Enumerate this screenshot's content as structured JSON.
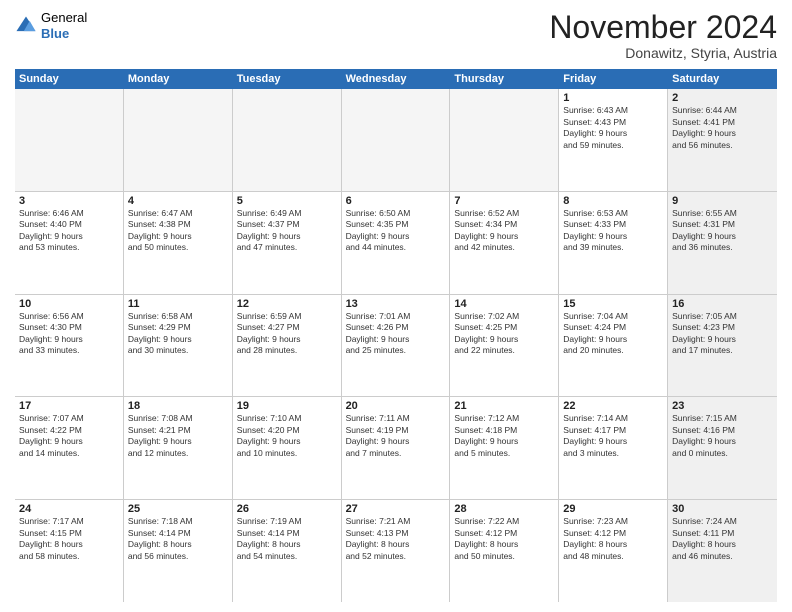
{
  "header": {
    "logo": {
      "general": "General",
      "blue": "Blue"
    },
    "title": "November 2024",
    "subtitle": "Donawitz, Styria, Austria"
  },
  "calendar": {
    "weekdays": [
      "Sunday",
      "Monday",
      "Tuesday",
      "Wednesday",
      "Thursday",
      "Friday",
      "Saturday"
    ],
    "rows": [
      {
        "cells": [
          {
            "empty": true
          },
          {
            "empty": true
          },
          {
            "empty": true
          },
          {
            "empty": true
          },
          {
            "empty": true
          },
          {
            "day": 1,
            "info": "Sunrise: 6:43 AM\nSunset: 4:43 PM\nDaylight: 9 hours\nand 59 minutes.",
            "shaded": false
          },
          {
            "day": 2,
            "info": "Sunrise: 6:44 AM\nSunset: 4:41 PM\nDaylight: 9 hours\nand 56 minutes.",
            "shaded": true
          }
        ]
      },
      {
        "cells": [
          {
            "day": 3,
            "info": "Sunrise: 6:46 AM\nSunset: 4:40 PM\nDaylight: 9 hours\nand 53 minutes.",
            "shaded": false
          },
          {
            "day": 4,
            "info": "Sunrise: 6:47 AM\nSunset: 4:38 PM\nDaylight: 9 hours\nand 50 minutes.",
            "shaded": false
          },
          {
            "day": 5,
            "info": "Sunrise: 6:49 AM\nSunset: 4:37 PM\nDaylight: 9 hours\nand 47 minutes.",
            "shaded": false
          },
          {
            "day": 6,
            "info": "Sunrise: 6:50 AM\nSunset: 4:35 PM\nDaylight: 9 hours\nand 44 minutes.",
            "shaded": false
          },
          {
            "day": 7,
            "info": "Sunrise: 6:52 AM\nSunset: 4:34 PM\nDaylight: 9 hours\nand 42 minutes.",
            "shaded": false
          },
          {
            "day": 8,
            "info": "Sunrise: 6:53 AM\nSunset: 4:33 PM\nDaylight: 9 hours\nand 39 minutes.",
            "shaded": false
          },
          {
            "day": 9,
            "info": "Sunrise: 6:55 AM\nSunset: 4:31 PM\nDaylight: 9 hours\nand 36 minutes.",
            "shaded": true
          }
        ]
      },
      {
        "cells": [
          {
            "day": 10,
            "info": "Sunrise: 6:56 AM\nSunset: 4:30 PM\nDaylight: 9 hours\nand 33 minutes.",
            "shaded": false
          },
          {
            "day": 11,
            "info": "Sunrise: 6:58 AM\nSunset: 4:29 PM\nDaylight: 9 hours\nand 30 minutes.",
            "shaded": false
          },
          {
            "day": 12,
            "info": "Sunrise: 6:59 AM\nSunset: 4:27 PM\nDaylight: 9 hours\nand 28 minutes.",
            "shaded": false
          },
          {
            "day": 13,
            "info": "Sunrise: 7:01 AM\nSunset: 4:26 PM\nDaylight: 9 hours\nand 25 minutes.",
            "shaded": false
          },
          {
            "day": 14,
            "info": "Sunrise: 7:02 AM\nSunset: 4:25 PM\nDaylight: 9 hours\nand 22 minutes.",
            "shaded": false
          },
          {
            "day": 15,
            "info": "Sunrise: 7:04 AM\nSunset: 4:24 PM\nDaylight: 9 hours\nand 20 minutes.",
            "shaded": false
          },
          {
            "day": 16,
            "info": "Sunrise: 7:05 AM\nSunset: 4:23 PM\nDaylight: 9 hours\nand 17 minutes.",
            "shaded": true
          }
        ]
      },
      {
        "cells": [
          {
            "day": 17,
            "info": "Sunrise: 7:07 AM\nSunset: 4:22 PM\nDaylight: 9 hours\nand 14 minutes.",
            "shaded": false
          },
          {
            "day": 18,
            "info": "Sunrise: 7:08 AM\nSunset: 4:21 PM\nDaylight: 9 hours\nand 12 minutes.",
            "shaded": false
          },
          {
            "day": 19,
            "info": "Sunrise: 7:10 AM\nSunset: 4:20 PM\nDaylight: 9 hours\nand 10 minutes.",
            "shaded": false
          },
          {
            "day": 20,
            "info": "Sunrise: 7:11 AM\nSunset: 4:19 PM\nDaylight: 9 hours\nand 7 minutes.",
            "shaded": false
          },
          {
            "day": 21,
            "info": "Sunrise: 7:12 AM\nSunset: 4:18 PM\nDaylight: 9 hours\nand 5 minutes.",
            "shaded": false
          },
          {
            "day": 22,
            "info": "Sunrise: 7:14 AM\nSunset: 4:17 PM\nDaylight: 9 hours\nand 3 minutes.",
            "shaded": false
          },
          {
            "day": 23,
            "info": "Sunrise: 7:15 AM\nSunset: 4:16 PM\nDaylight: 9 hours\nand 0 minutes.",
            "shaded": true
          }
        ]
      },
      {
        "cells": [
          {
            "day": 24,
            "info": "Sunrise: 7:17 AM\nSunset: 4:15 PM\nDaylight: 8 hours\nand 58 minutes.",
            "shaded": false
          },
          {
            "day": 25,
            "info": "Sunrise: 7:18 AM\nSunset: 4:14 PM\nDaylight: 8 hours\nand 56 minutes.",
            "shaded": false
          },
          {
            "day": 26,
            "info": "Sunrise: 7:19 AM\nSunset: 4:14 PM\nDaylight: 8 hours\nand 54 minutes.",
            "shaded": false
          },
          {
            "day": 27,
            "info": "Sunrise: 7:21 AM\nSunset: 4:13 PM\nDaylight: 8 hours\nand 52 minutes.",
            "shaded": false
          },
          {
            "day": 28,
            "info": "Sunrise: 7:22 AM\nSunset: 4:12 PM\nDaylight: 8 hours\nand 50 minutes.",
            "shaded": false
          },
          {
            "day": 29,
            "info": "Sunrise: 7:23 AM\nSunset: 4:12 PM\nDaylight: 8 hours\nand 48 minutes.",
            "shaded": false
          },
          {
            "day": 30,
            "info": "Sunrise: 7:24 AM\nSunset: 4:11 PM\nDaylight: 8 hours\nand 46 minutes.",
            "shaded": true
          }
        ]
      }
    ]
  }
}
